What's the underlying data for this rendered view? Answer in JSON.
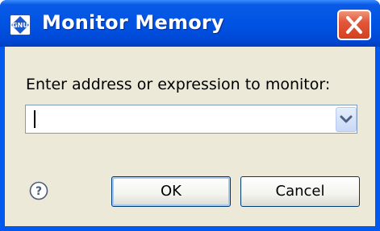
{
  "window": {
    "title": "Monitor Memory",
    "app_icon": "gnu-icon",
    "close_icon": "close-icon"
  },
  "form": {
    "prompt": "Enter address or expression to monitor:",
    "expression_value": "",
    "dropdown_icon": "chevron-down-icon"
  },
  "buttons": {
    "ok_label": "OK",
    "cancel_label": "Cancel",
    "help_icon": "help-icon"
  },
  "colors": {
    "titlebar": "#0054e3",
    "client_background": "#ece9d8",
    "close_button": "#d3411f"
  }
}
